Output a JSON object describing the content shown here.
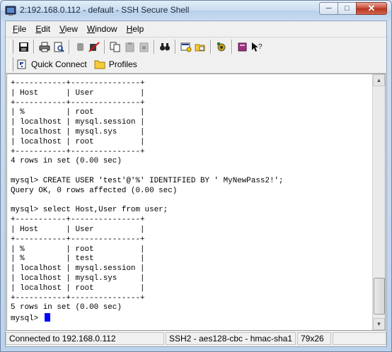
{
  "window": {
    "title": "2:192.168.0.112 - default - SSH Secure Shell",
    "minimize_glyph": "─",
    "maximize_glyph": "□",
    "close_glyph": "✕"
  },
  "menu": {
    "items": [
      {
        "prefix": "",
        "accel": "F",
        "rest": "ile"
      },
      {
        "prefix": "",
        "accel": "E",
        "rest": "dit"
      },
      {
        "prefix": "",
        "accel": "V",
        "rest": "iew"
      },
      {
        "prefix": "",
        "accel": "W",
        "rest": "indow"
      },
      {
        "prefix": "",
        "accel": "H",
        "rest": "elp"
      }
    ]
  },
  "quickbar": {
    "quick_connect": "Quick Connect",
    "profiles": "Profiles"
  },
  "terminal": {
    "lines": "+-----------+---------------+\n| Host      | User          |\n+-----------+---------------+\n| %         | root          |\n| localhost | mysql.session |\n| localhost | mysql.sys     |\n| localhost | root          |\n+-----------+---------------+\n4 rows in set (0.00 sec)\n\nmysql> CREATE USER 'test'@'%' IDENTIFIED BY ' MyNewPass2!';\nQuery OK, 0 rows affected (0.00 sec)\n\nmysql> select Host,User from user;\n+-----------+---------------+\n| Host      | User          |\n+-----------+---------------+\n| %         | root          |\n| %         | test          |\n| localhost | mysql.session |\n| localhost | mysql.sys     |\n| localhost | root          |\n+-----------+---------------+\n5 rows in set (0.00 sec)\n",
    "prompt": "mysql> "
  },
  "status": {
    "connection": "Connected to 192.168.0.112",
    "cipher": "SSH2 - aes128-cbc - hmac-sha1",
    "size": "79x26"
  },
  "colors": {
    "cursor": "#0000ff",
    "close_button": "#c8452f"
  }
}
